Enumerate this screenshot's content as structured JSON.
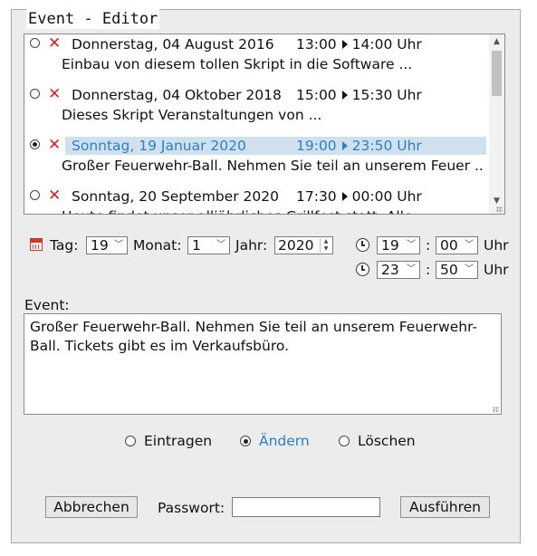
{
  "editor": {
    "title": "Event - Editor"
  },
  "events": [
    {
      "date": "Donnerstag, 04 August 2016",
      "start": "13:00",
      "end": "14:00 Uhr",
      "text": "Einbau von diesem tollen Skript in die Software ...",
      "selected": false
    },
    {
      "date": "Donnerstag, 04 Oktober 2018",
      "start": "15:00",
      "end": "15:30 Uhr",
      "text": "Dieses Skript Veranstaltungen von ...",
      "selected": false
    },
    {
      "date": "Sonntag, 19 Januar 2020",
      "start": "19:00",
      "end": "23:50 Uhr",
      "text": "Großer Feuerwehr-Ball. Nehmen Sie teil an unserem Feuer ..",
      "selected": true
    },
    {
      "date": "Sonntag, 20 September 2020",
      "start": "17:30",
      "end": "00:00 Uhr",
      "text": "Heute findet unser alljährliches Grillfest statt. Alle",
      "selected": false
    }
  ],
  "date_row": {
    "day_label": "Tag:",
    "day_value": "19",
    "month_label": "Monat:",
    "month_value": "1",
    "year_label": "Jahr:",
    "year_value": "2020"
  },
  "time": {
    "start_hour": "19",
    "start_minute": "00",
    "end_hour": "23",
    "end_minute": "50",
    "separator": ":",
    "unit": "Uhr"
  },
  "event_field": {
    "label": "Event:",
    "value": "Großer Feuerwehr-Ball. Nehmen Sie teil an unserem Feuerwehr-Ball. Tickets gibt es im Verkaufsbüro."
  },
  "actions": {
    "options": [
      "Eintragen",
      "Ändern",
      "Löschen"
    ],
    "selected": "Ändern"
  },
  "footer": {
    "cancel_label": "Abbrechen",
    "password_label": "Passwort:",
    "password_value": "",
    "submit_label": "Ausführen"
  },
  "colors": {
    "selection_text": "#2f7fc1",
    "selection_bg": "#cfe1ef",
    "delete": "#d21f1f"
  },
  "icons": [
    "delete-icon",
    "calendar-icon",
    "clock-icon",
    "chevron-down-icon",
    "resize-grip-icon"
  ]
}
